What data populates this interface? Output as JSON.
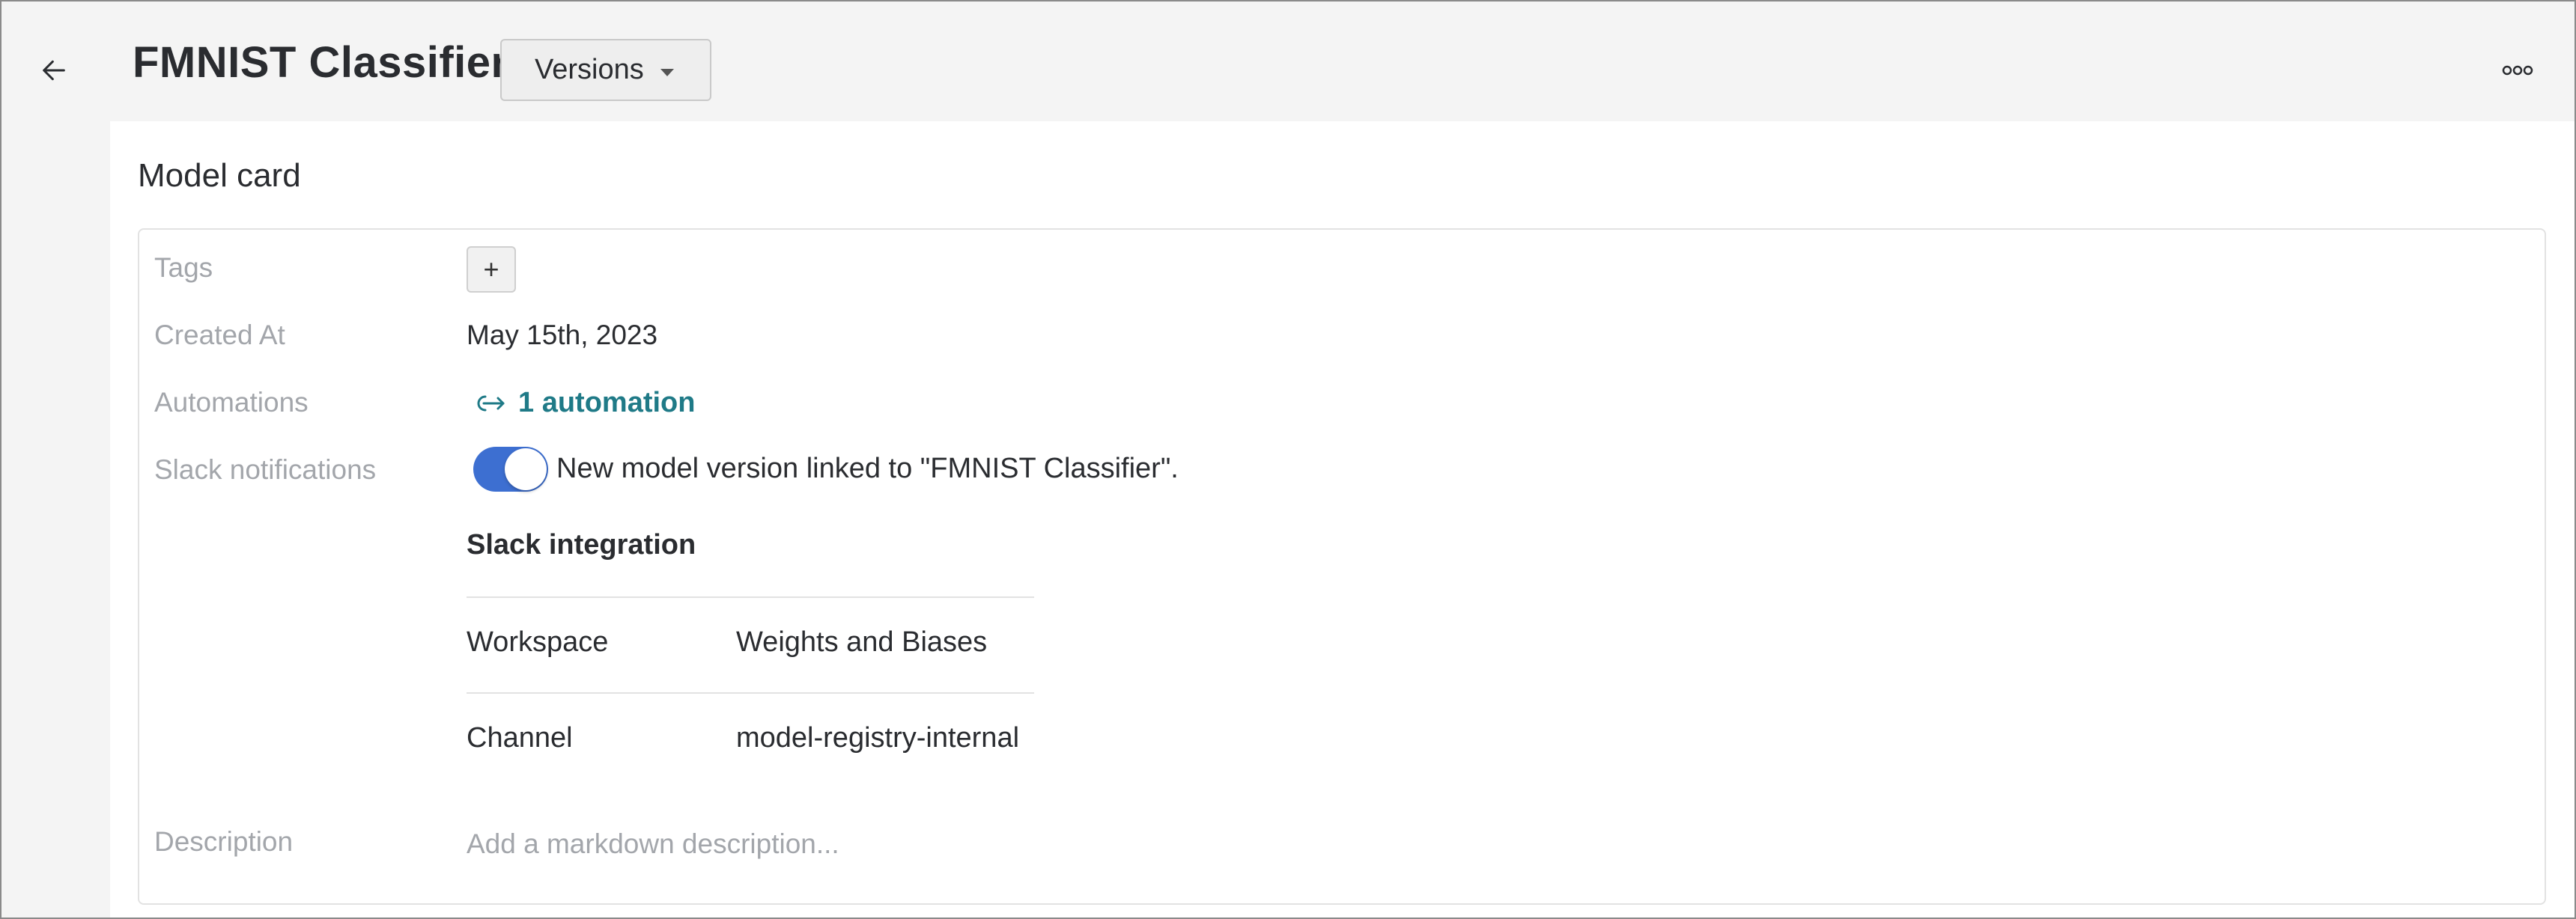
{
  "header": {
    "title": "FMNIST Classifier",
    "versions_label": "Versions"
  },
  "section_title": "Model card",
  "fields": {
    "tags_label": "Tags",
    "add_tag_label": "+",
    "created_at_label": "Created At",
    "created_at_value": "May 15th, 2023",
    "automations_label": "Automations",
    "automations_value": "1 automation",
    "slack_label": "Slack notifications",
    "slack_toggle_on": true,
    "slack_toggle_text": "New model version linked to \"FMNIST Classifier\".",
    "description_label": "Description",
    "description_placeholder": "Add a markdown description..."
  },
  "slack_integration": {
    "heading": "Slack integration",
    "rows": [
      {
        "key": "Workspace",
        "value": "Weights and Biases"
      },
      {
        "key": "Channel",
        "value": "model-registry-internal"
      }
    ]
  },
  "colors": {
    "accent_link": "#1f7a87",
    "toggle_on": "#3d6fd1",
    "muted_label": "#a3a6ab",
    "header_bg": "#f4f4f4"
  },
  "icons": {
    "back": "arrow-left-icon",
    "more": "more-horizontal-icon",
    "automation": "link-arrow-icon",
    "caret": "chevron-down-icon"
  }
}
